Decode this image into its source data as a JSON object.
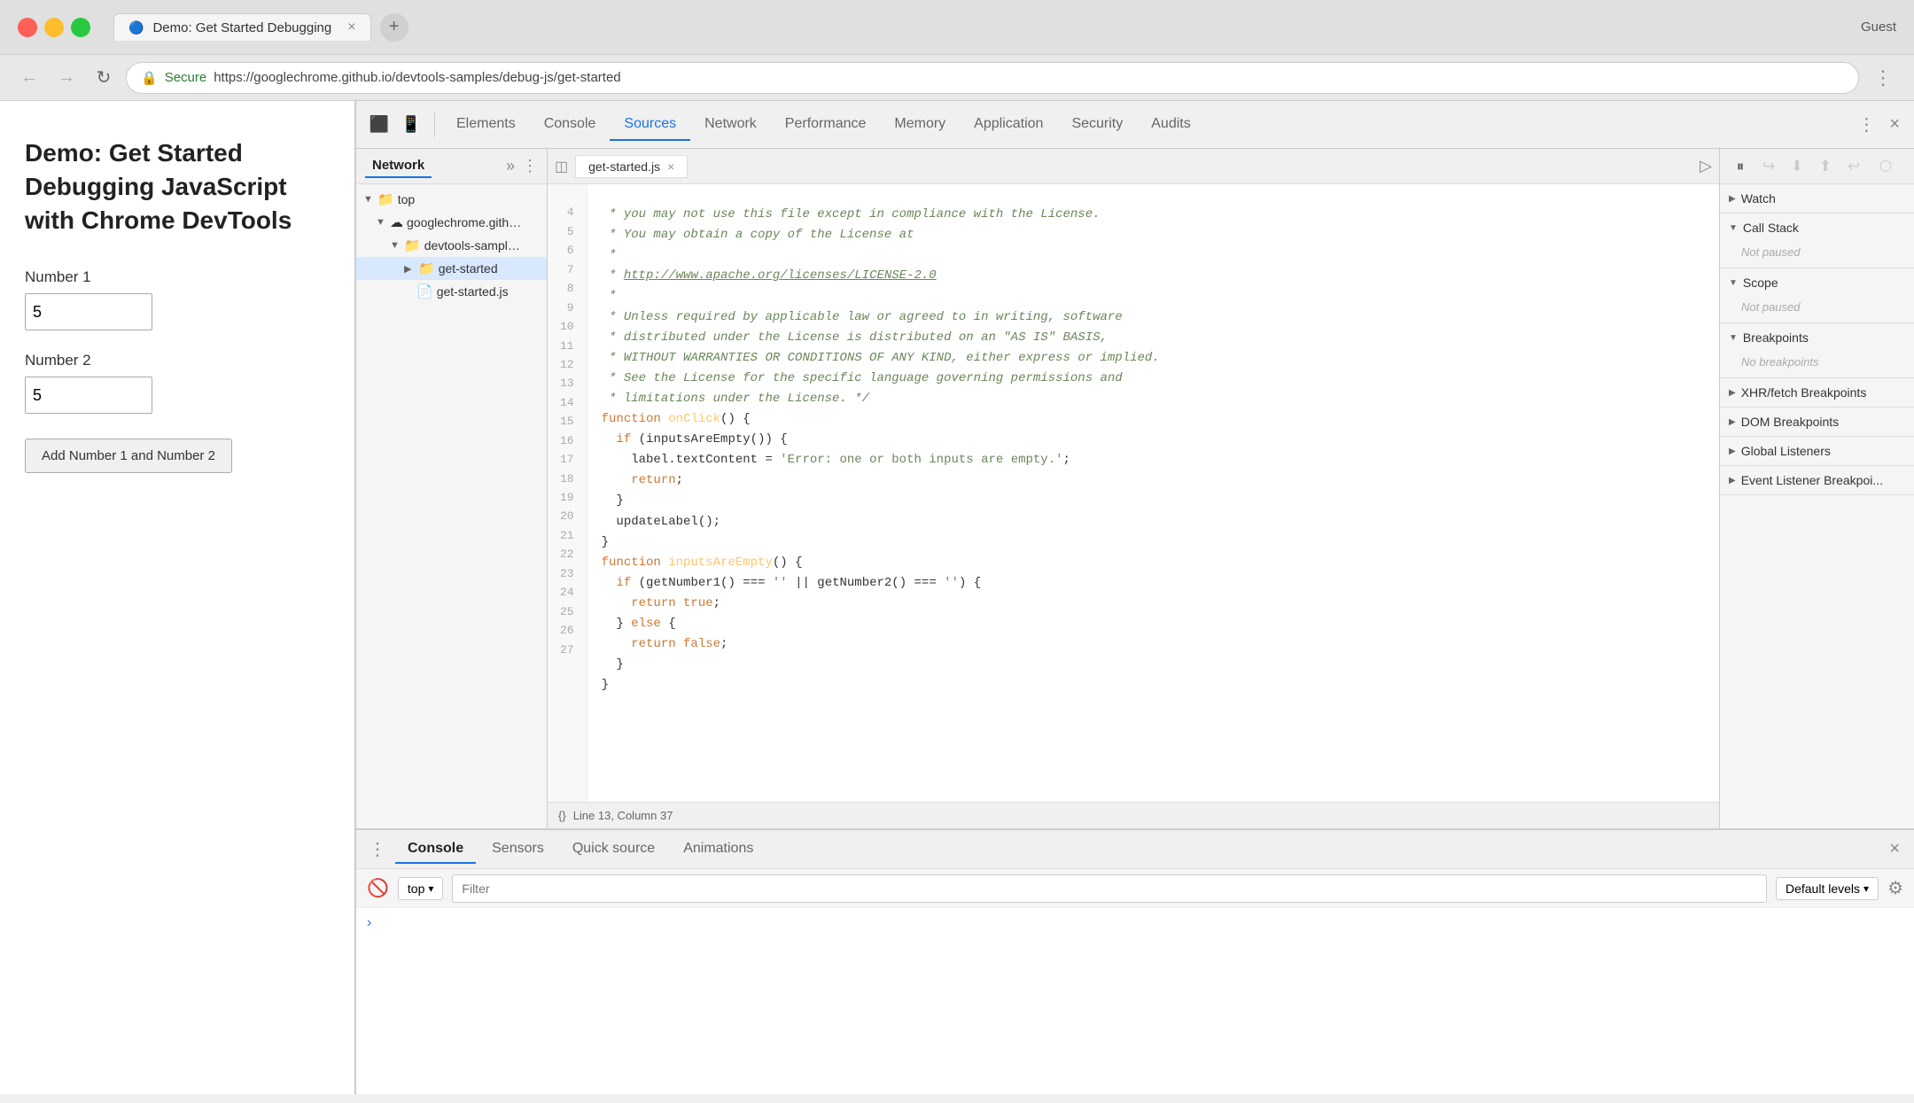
{
  "browser": {
    "tab_title": "Demo: Get Started Debugging",
    "tab_close": "×",
    "new_tab": "+",
    "secure_label": "Secure",
    "url": "https://googlechrome.github.io/devtools-samples/debug-js/get-started",
    "account": "Guest"
  },
  "webpage": {
    "title": "Demo: Get Started Debugging JavaScript with Chrome DevTools",
    "number1_label": "Number 1",
    "number1_value": "5",
    "number2_label": "Number 2",
    "number2_value": "5",
    "add_button": "Add Number 1 and Number 2"
  },
  "devtools": {
    "tabs": [
      "Elements",
      "Console",
      "Sources",
      "Network",
      "Performance",
      "Memory",
      "Application",
      "Security",
      "Audits"
    ],
    "active_tab": "Sources"
  },
  "file_panel": {
    "tabs": [
      "Network"
    ],
    "more_label": "»",
    "kebab": "⋮",
    "tree": [
      {
        "label": "top",
        "level": 0,
        "icon": "📁",
        "expanded": true,
        "arrow": "▼"
      },
      {
        "label": "googlechrome.github",
        "level": 1,
        "icon": "☁",
        "expanded": true,
        "arrow": "▼"
      },
      {
        "label": "devtools-samples/",
        "level": 2,
        "icon": "📁",
        "expanded": true,
        "arrow": "▼"
      },
      {
        "label": "get-started",
        "level": 3,
        "icon": "📁",
        "expanded": false,
        "arrow": "▶"
      },
      {
        "label": "get-started.js",
        "level": 3,
        "icon": "📄",
        "arrow": ""
      }
    ]
  },
  "code_editor": {
    "filename": "get-started.js",
    "tab_close": "×",
    "lines": [
      {
        "num": 4,
        "content": " * you may not use this file except in compliance with the License.",
        "type": "comment"
      },
      {
        "num": 5,
        "content": " * You may obtain a copy of the License at",
        "type": "comment"
      },
      {
        "num": 6,
        "content": " *",
        "type": "comment"
      },
      {
        "num": 7,
        "content": " * http://www.apache.org/licenses/LICENSE-2.0",
        "type": "comment_url"
      },
      {
        "num": 8,
        "content": " *",
        "type": "comment"
      },
      {
        "num": 9,
        "content": " * Unless required by applicable law or agreed to in writing, software",
        "type": "comment"
      },
      {
        "num": 10,
        "content": " * distributed under the License is distributed on an \"AS IS\" BASIS,",
        "type": "comment"
      },
      {
        "num": 11,
        "content": " * WITHOUT WARRANTIES OR CONDITIONS OF ANY KIND, either express or implied.",
        "type": "comment"
      },
      {
        "num": 12,
        "content": " * See the License for the specific language governing permissions and",
        "type": "comment"
      },
      {
        "num": 13,
        "content": " * limitations under the License. */",
        "type": "comment"
      },
      {
        "num": 14,
        "content": "function onClick() {",
        "type": "code"
      },
      {
        "num": 15,
        "content": "  if (inputsAreEmpty()) {",
        "type": "code"
      },
      {
        "num": 16,
        "content": "    label.textContent = 'Error: one or both inputs are empty.';",
        "type": "code"
      },
      {
        "num": 17,
        "content": "    return;",
        "type": "code"
      },
      {
        "num": 18,
        "content": "  }",
        "type": "code"
      },
      {
        "num": 19,
        "content": "  updateLabel();",
        "type": "code"
      },
      {
        "num": 20,
        "content": "}",
        "type": "code"
      },
      {
        "num": 21,
        "content": "function inputsAreEmpty() {",
        "type": "code"
      },
      {
        "num": 22,
        "content": "  if (getNumber1() === '' || getNumber2() === '') {",
        "type": "code"
      },
      {
        "num": 23,
        "content": "    return true;",
        "type": "code"
      },
      {
        "num": 24,
        "content": "  } else {",
        "type": "code"
      },
      {
        "num": 25,
        "content": "    return false;",
        "type": "code"
      },
      {
        "num": 26,
        "content": "  }",
        "type": "code"
      },
      {
        "num": 27,
        "content": "}",
        "type": "code"
      }
    ],
    "status": "Line 13, Column 37"
  },
  "debug_panel": {
    "toolbar_buttons": [
      "⏸",
      "⟳",
      "⬇",
      "⬆",
      "↩"
    ],
    "sections": [
      {
        "title": "Watch",
        "expanded": false,
        "content": null
      },
      {
        "title": "Call Stack",
        "expanded": true,
        "content": "Not paused"
      },
      {
        "title": "Scope",
        "expanded": true,
        "content": "Not paused"
      },
      {
        "title": "Breakpoints",
        "expanded": true,
        "content": "No breakpoints"
      },
      {
        "title": "XHR/fetch Breakpoints",
        "expanded": false,
        "content": null
      },
      {
        "title": "DOM Breakpoints",
        "expanded": false,
        "content": null
      },
      {
        "title": "Global Listeners",
        "expanded": false,
        "content": null
      },
      {
        "title": "Event Listener Breakpoi...",
        "expanded": false,
        "content": null
      }
    ]
  },
  "console_panel": {
    "tabs": [
      "Console",
      "Sensors",
      "Quick source",
      "Animations"
    ],
    "active_tab": "Console",
    "context": "top",
    "filter_placeholder": "Filter",
    "levels": "Default levels"
  },
  "icons": {
    "back": "←",
    "forward": "→",
    "refresh": "↻",
    "lock": "🔒",
    "more": "⋮",
    "close": "×",
    "chevron_down": "▾",
    "expand_panel": "⤢",
    "toggle_panel": "▣",
    "arrow_right": "▶",
    "arrow_down": "▼"
  }
}
